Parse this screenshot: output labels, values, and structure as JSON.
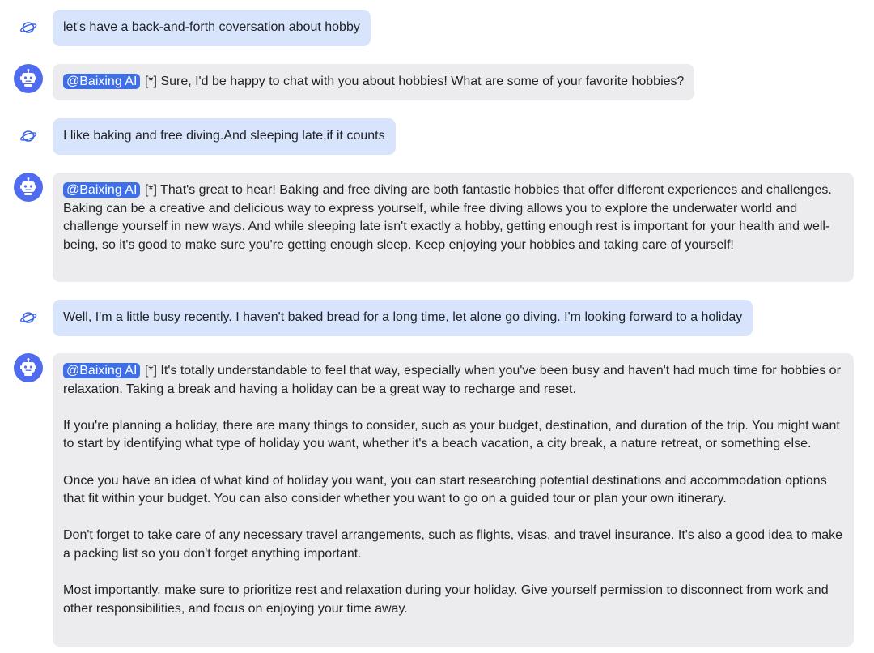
{
  "bot": {
    "mention": "@Baixing AI"
  },
  "messages": [
    {
      "role": "user",
      "text": "let's have a back-and-forth coversation about hobby"
    },
    {
      "role": "bot",
      "prefix": " [*] ",
      "paragraphs": [
        "Sure, I'd be happy to chat with you about hobbies! What are some of your favorite hobbies?"
      ]
    },
    {
      "role": "user",
      "text": "I like baking and free diving.And sleeping late,if it counts"
    },
    {
      "role": "bot",
      "prefix": " [*] ",
      "paragraphs": [
        "That's great to hear! Baking and free diving are both fantastic hobbies that offer different experiences and challenges. Baking can be a creative and delicious way to express yourself, while free diving allows you to explore the underwater world and challenge yourself in new ways. And while sleeping late isn't exactly a hobby, getting enough rest is important for your health and well-being, so it's good to make sure you're getting enough sleep. Keep enjoying your hobbies and taking care of yourself!"
      ]
    },
    {
      "role": "user",
      "text": "Well, I'm a little busy recently. I haven't baked bread for a long time, let alone go diving. I'm looking forward to a holiday"
    },
    {
      "role": "bot",
      "prefix": " [*] ",
      "paragraphs": [
        "It's totally understandable to feel that way, especially when you've been busy and haven't had much time for hobbies or relaxation. Taking a break and having a holiday can be a great way to recharge and reset.",
        "If you're planning a holiday, there are many things to consider, such as your budget, destination, and duration of the trip. You might want to start by identifying what type of holiday you want, whether it's a beach vacation, a city break, a nature retreat, or something else.",
        "Once you have an idea of what kind of holiday you want, you can start researching potential destinations and accommodation options that fit within your budget. You can also consider whether you want to go on a guided tour or plan your own itinerary.",
        "Don't forget to take care of any necessary travel arrangements, such as flights, visas, and travel insurance. It's also a good idea to make a packing list so you don't forget anything important.",
        "Most importantly, make sure to prioritize rest and relaxation during your holiday. Give yourself permission to disconnect from work and other responsibilities, and focus on enjoying your time away."
      ]
    }
  ]
}
